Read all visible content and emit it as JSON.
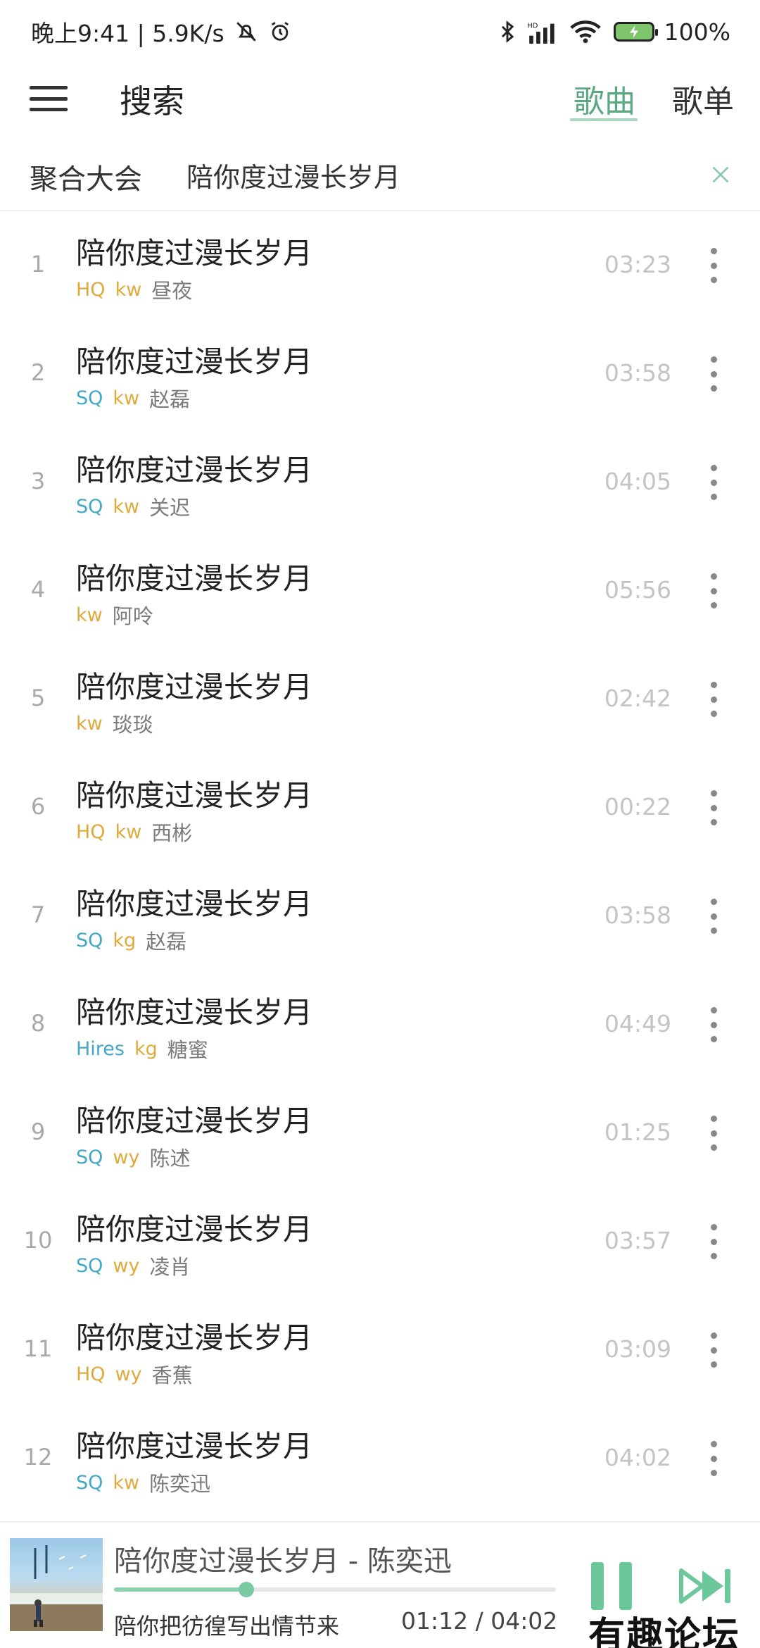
{
  "status_bar": {
    "time_speed": "晚上9:41 | 5.9K/s",
    "network_badge": "HD",
    "battery": "100%"
  },
  "header": {
    "title": "搜索",
    "tabs": [
      {
        "label": "歌曲",
        "active": true
      },
      {
        "label": "歌单",
        "active": false
      }
    ]
  },
  "search": {
    "source": "聚合大会",
    "query": "陪你度过漫长岁月"
  },
  "songs": [
    {
      "index": "1",
      "title": "陪你度过漫长岁月",
      "quality": "HQ",
      "source": "kw",
      "artist": "昼夜",
      "duration": "03:23"
    },
    {
      "index": "2",
      "title": "陪你度过漫长岁月",
      "quality": "SQ",
      "source": "kw",
      "artist": "赵磊",
      "duration": "03:58"
    },
    {
      "index": "3",
      "title": "陪你度过漫长岁月",
      "quality": "SQ",
      "source": "kw",
      "artist": "关迟",
      "duration": "04:05"
    },
    {
      "index": "4",
      "title": "陪你度过漫长岁月",
      "quality": "",
      "source": "kw",
      "artist": "阿呤",
      "duration": "05:56"
    },
    {
      "index": "5",
      "title": "陪你度过漫长岁月",
      "quality": "",
      "source": "kw",
      "artist": "琰琰",
      "duration": "02:42"
    },
    {
      "index": "6",
      "title": "陪你度过漫长岁月",
      "quality": "HQ",
      "source": "kw",
      "artist": "西彬",
      "duration": "00:22"
    },
    {
      "index": "7",
      "title": "陪你度过漫长岁月",
      "quality": "SQ",
      "source": "kg",
      "artist": "赵磊",
      "duration": "03:58"
    },
    {
      "index": "8",
      "title": "陪你度过漫长岁月",
      "quality": "Hires",
      "source": "kg",
      "artist": "糖蜜",
      "duration": "04:49"
    },
    {
      "index": "9",
      "title": "陪你度过漫长岁月",
      "quality": "SQ",
      "source": "wy",
      "artist": "陈述",
      "duration": "01:25"
    },
    {
      "index": "10",
      "title": "陪你度过漫长岁月",
      "quality": "SQ",
      "source": "wy",
      "artist": "凌肖",
      "duration": "03:57"
    },
    {
      "index": "11",
      "title": "陪你度过漫长岁月",
      "quality": "HQ",
      "source": "wy",
      "artist": "香蕉",
      "duration": "03:09"
    },
    {
      "index": "12",
      "title": "陪你度过漫长岁月",
      "quality": "SQ",
      "source": "kw",
      "artist": "陈奕迅",
      "duration": "04:02"
    }
  ],
  "player": {
    "now_playing": "陪你度过漫长岁月 - 陈奕迅",
    "lyric": "陪你把彷徨写出情节来",
    "time": "01:12 / 04:02",
    "progress": 0.3
  },
  "watermark": "有趣论坛",
  "colors": {
    "accent": "#5aa882",
    "quality_gold": "#e0a93b",
    "quality_blue": "#43a7c6",
    "play_green": "#6cc79a"
  }
}
